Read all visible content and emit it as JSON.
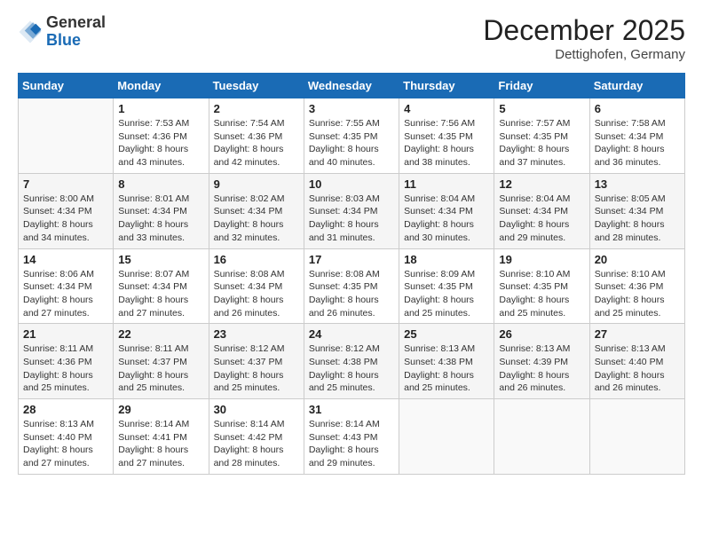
{
  "header": {
    "logo_general": "General",
    "logo_blue": "Blue",
    "month_title": "December 2025",
    "location": "Dettighofen, Germany"
  },
  "days_of_week": [
    "Sunday",
    "Monday",
    "Tuesday",
    "Wednesday",
    "Thursday",
    "Friday",
    "Saturday"
  ],
  "weeks": [
    [
      {
        "day": "",
        "sunrise": "",
        "sunset": "",
        "daylight": ""
      },
      {
        "day": "1",
        "sunrise": "Sunrise: 7:53 AM",
        "sunset": "Sunset: 4:36 PM",
        "daylight": "Daylight: 8 hours and 43 minutes."
      },
      {
        "day": "2",
        "sunrise": "Sunrise: 7:54 AM",
        "sunset": "Sunset: 4:36 PM",
        "daylight": "Daylight: 8 hours and 42 minutes."
      },
      {
        "day": "3",
        "sunrise": "Sunrise: 7:55 AM",
        "sunset": "Sunset: 4:35 PM",
        "daylight": "Daylight: 8 hours and 40 minutes."
      },
      {
        "day": "4",
        "sunrise": "Sunrise: 7:56 AM",
        "sunset": "Sunset: 4:35 PM",
        "daylight": "Daylight: 8 hours and 38 minutes."
      },
      {
        "day": "5",
        "sunrise": "Sunrise: 7:57 AM",
        "sunset": "Sunset: 4:35 PM",
        "daylight": "Daylight: 8 hours and 37 minutes."
      },
      {
        "day": "6",
        "sunrise": "Sunrise: 7:58 AM",
        "sunset": "Sunset: 4:34 PM",
        "daylight": "Daylight: 8 hours and 36 minutes."
      }
    ],
    [
      {
        "day": "7",
        "sunrise": "Sunrise: 8:00 AM",
        "sunset": "Sunset: 4:34 PM",
        "daylight": "Daylight: 8 hours and 34 minutes."
      },
      {
        "day": "8",
        "sunrise": "Sunrise: 8:01 AM",
        "sunset": "Sunset: 4:34 PM",
        "daylight": "Daylight: 8 hours and 33 minutes."
      },
      {
        "day": "9",
        "sunrise": "Sunrise: 8:02 AM",
        "sunset": "Sunset: 4:34 PM",
        "daylight": "Daylight: 8 hours and 32 minutes."
      },
      {
        "day": "10",
        "sunrise": "Sunrise: 8:03 AM",
        "sunset": "Sunset: 4:34 PM",
        "daylight": "Daylight: 8 hours and 31 minutes."
      },
      {
        "day": "11",
        "sunrise": "Sunrise: 8:04 AM",
        "sunset": "Sunset: 4:34 PM",
        "daylight": "Daylight: 8 hours and 30 minutes."
      },
      {
        "day": "12",
        "sunrise": "Sunrise: 8:04 AM",
        "sunset": "Sunset: 4:34 PM",
        "daylight": "Daylight: 8 hours and 29 minutes."
      },
      {
        "day": "13",
        "sunrise": "Sunrise: 8:05 AM",
        "sunset": "Sunset: 4:34 PM",
        "daylight": "Daylight: 8 hours and 28 minutes."
      }
    ],
    [
      {
        "day": "14",
        "sunrise": "Sunrise: 8:06 AM",
        "sunset": "Sunset: 4:34 PM",
        "daylight": "Daylight: 8 hours and 27 minutes."
      },
      {
        "day": "15",
        "sunrise": "Sunrise: 8:07 AM",
        "sunset": "Sunset: 4:34 PM",
        "daylight": "Daylight: 8 hours and 27 minutes."
      },
      {
        "day": "16",
        "sunrise": "Sunrise: 8:08 AM",
        "sunset": "Sunset: 4:34 PM",
        "daylight": "Daylight: 8 hours and 26 minutes."
      },
      {
        "day": "17",
        "sunrise": "Sunrise: 8:08 AM",
        "sunset": "Sunset: 4:35 PM",
        "daylight": "Daylight: 8 hours and 26 minutes."
      },
      {
        "day": "18",
        "sunrise": "Sunrise: 8:09 AM",
        "sunset": "Sunset: 4:35 PM",
        "daylight": "Daylight: 8 hours and 25 minutes."
      },
      {
        "day": "19",
        "sunrise": "Sunrise: 8:10 AM",
        "sunset": "Sunset: 4:35 PM",
        "daylight": "Daylight: 8 hours and 25 minutes."
      },
      {
        "day": "20",
        "sunrise": "Sunrise: 8:10 AM",
        "sunset": "Sunset: 4:36 PM",
        "daylight": "Daylight: 8 hours and 25 minutes."
      }
    ],
    [
      {
        "day": "21",
        "sunrise": "Sunrise: 8:11 AM",
        "sunset": "Sunset: 4:36 PM",
        "daylight": "Daylight: 8 hours and 25 minutes."
      },
      {
        "day": "22",
        "sunrise": "Sunrise: 8:11 AM",
        "sunset": "Sunset: 4:37 PM",
        "daylight": "Daylight: 8 hours and 25 minutes."
      },
      {
        "day": "23",
        "sunrise": "Sunrise: 8:12 AM",
        "sunset": "Sunset: 4:37 PM",
        "daylight": "Daylight: 8 hours and 25 minutes."
      },
      {
        "day": "24",
        "sunrise": "Sunrise: 8:12 AM",
        "sunset": "Sunset: 4:38 PM",
        "daylight": "Daylight: 8 hours and 25 minutes."
      },
      {
        "day": "25",
        "sunrise": "Sunrise: 8:13 AM",
        "sunset": "Sunset: 4:38 PM",
        "daylight": "Daylight: 8 hours and 25 minutes."
      },
      {
        "day": "26",
        "sunrise": "Sunrise: 8:13 AM",
        "sunset": "Sunset: 4:39 PM",
        "daylight": "Daylight: 8 hours and 26 minutes."
      },
      {
        "day": "27",
        "sunrise": "Sunrise: 8:13 AM",
        "sunset": "Sunset: 4:40 PM",
        "daylight": "Daylight: 8 hours and 26 minutes."
      }
    ],
    [
      {
        "day": "28",
        "sunrise": "Sunrise: 8:13 AM",
        "sunset": "Sunset: 4:40 PM",
        "daylight": "Daylight: 8 hours and 27 minutes."
      },
      {
        "day": "29",
        "sunrise": "Sunrise: 8:14 AM",
        "sunset": "Sunset: 4:41 PM",
        "daylight": "Daylight: 8 hours and 27 minutes."
      },
      {
        "day": "30",
        "sunrise": "Sunrise: 8:14 AM",
        "sunset": "Sunset: 4:42 PM",
        "daylight": "Daylight: 8 hours and 28 minutes."
      },
      {
        "day": "31",
        "sunrise": "Sunrise: 8:14 AM",
        "sunset": "Sunset: 4:43 PM",
        "daylight": "Daylight: 8 hours and 29 minutes."
      },
      {
        "day": "",
        "sunrise": "",
        "sunset": "",
        "daylight": ""
      },
      {
        "day": "",
        "sunrise": "",
        "sunset": "",
        "daylight": ""
      },
      {
        "day": "",
        "sunrise": "",
        "sunset": "",
        "daylight": ""
      }
    ]
  ]
}
